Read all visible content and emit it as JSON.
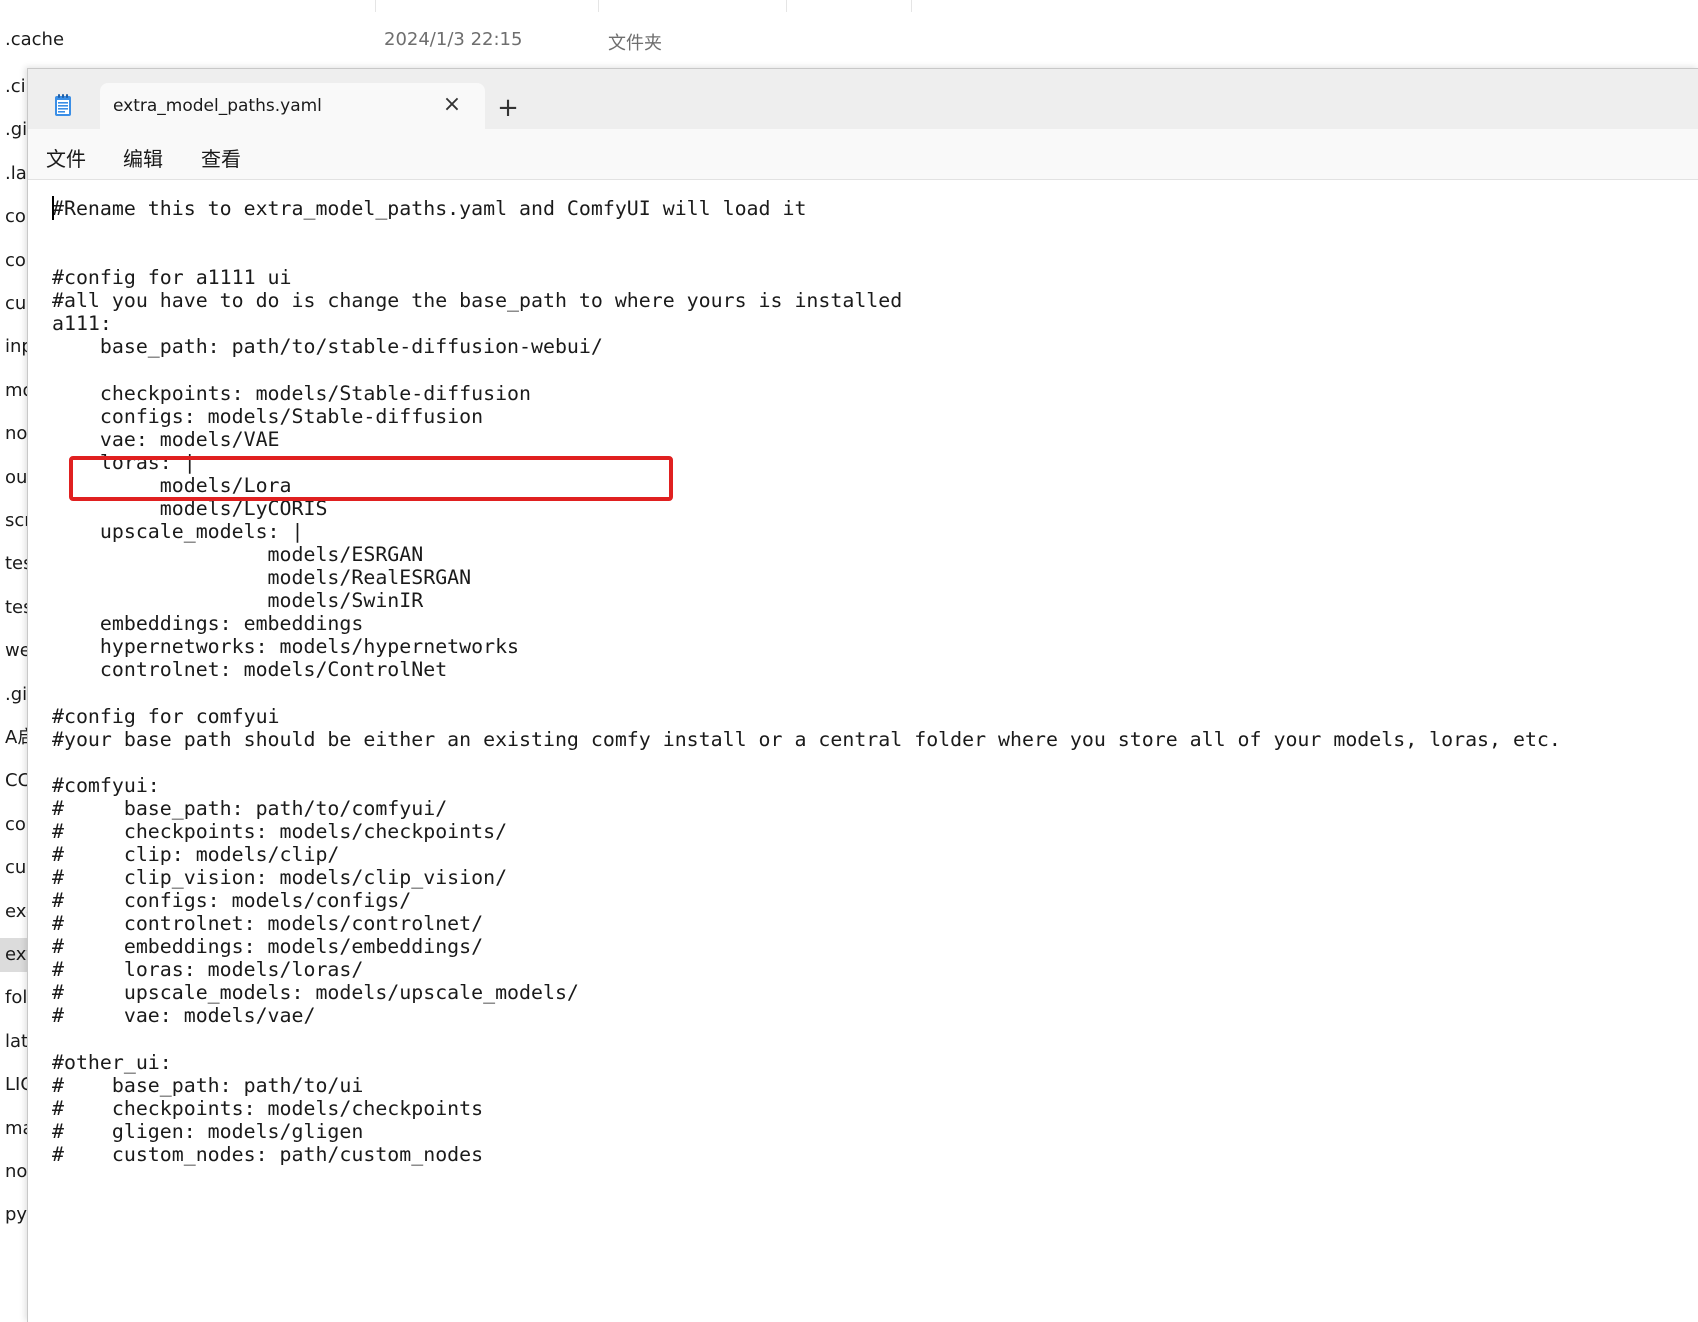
{
  "explorer": {
    "first_row": {
      "name": ".cache",
      "date": "2024/1/3 22:15",
      "type": "文件夹"
    },
    "items": [
      ".ci",
      ".gi",
      ".la",
      "co",
      "co",
      "cu",
      "inp",
      "mo",
      "no",
      "ou",
      "scr",
      "tes",
      "tes",
      "we",
      ".gi",
      "A启",
      "CC",
      "co",
      "cu",
      "exe",
      "ext",
      "fol",
      "lat",
      "LIC",
      "ma",
      "no",
      "py"
    ],
    "selected_index": 20
  },
  "notepad": {
    "app_icon": "notepad-icon",
    "tab_title": "extra_model_paths.yaml",
    "tab_close_icon": "×",
    "new_tab_icon": "+",
    "menu": [
      "文件",
      "编辑",
      "查看"
    ],
    "lines": [
      "#Rename this to extra_model_paths.yaml and ComfyUI will load it",
      "",
      "",
      "#config for a1111 ui",
      "#all you have to do is change the base_path to where yours is installed",
      "a111:",
      "    base_path: path/to/stable-diffusion-webui/",
      "",
      "    checkpoints: models/Stable-diffusion",
      "    configs: models/Stable-diffusion",
      "    vae: models/VAE",
      "    loras: |",
      "         models/Lora",
      "         models/LyCORIS",
      "    upscale_models: |",
      "                  models/ESRGAN",
      "                  models/RealESRGAN",
      "                  models/SwinIR",
      "    embeddings: embeddings",
      "    hypernetworks: models/hypernetworks",
      "    controlnet: models/ControlNet",
      "",
      "#config for comfyui",
      "#your base path should be either an existing comfy install or a central folder where you store all of your models, loras, etc.",
      "",
      "#comfyui:",
      "#     base_path: path/to/comfyui/",
      "#     checkpoints: models/checkpoints/",
      "#     clip: models/clip/",
      "#     clip_vision: models/clip_vision/",
      "#     configs: models/configs/",
      "#     controlnet: models/controlnet/",
      "#     embeddings: models/embeddings/",
      "#     loras: models/loras/",
      "#     upscale_models: models/upscale_models/",
      "#     vae: models/vae/",
      "",
      "#other_ui:",
      "#    base_path: path/to/ui",
      "#    checkpoints: models/checkpoints",
      "#    gligen: models/gligen",
      "#    custom_nodes: path/custom_nodes"
    ],
    "highlight_color": "#e02020"
  }
}
